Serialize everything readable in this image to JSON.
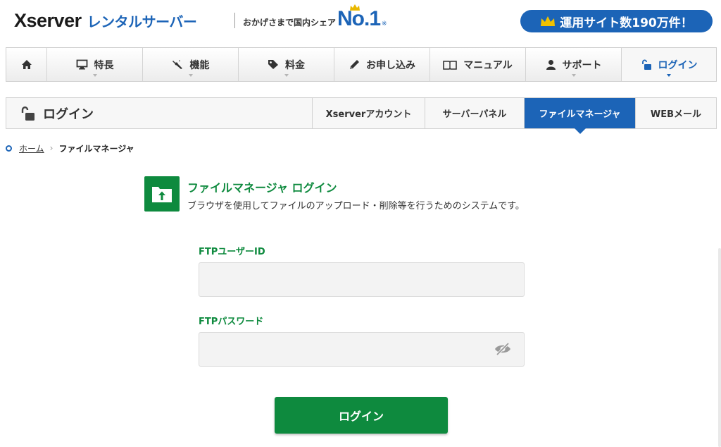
{
  "header": {
    "logo_main": "Xserver",
    "logo_sub": "レンタルサーバー",
    "tagline_text": "おかげさまで国内シェア",
    "tagline_no1": "No.1",
    "tagline_note": "※",
    "badge_text": "運用サイト数190万件！"
  },
  "nav": {
    "items": [
      {
        "label": "",
        "icon": "home-icon"
      },
      {
        "label": "特長",
        "icon": "monitor-icon"
      },
      {
        "label": "機能",
        "icon": "tools-icon"
      },
      {
        "label": "料金",
        "icon": "price-tag-icon"
      },
      {
        "label": "お申し込み",
        "icon": "pencil-icon"
      },
      {
        "label": "マニュアル",
        "icon": "book-icon"
      },
      {
        "label": "サポート",
        "icon": "user-icon"
      },
      {
        "label": "ログイン",
        "icon": "unlock-icon"
      }
    ]
  },
  "subnav": {
    "title": "ログイン",
    "tabs": [
      {
        "label": "Xserverアカウント"
      },
      {
        "label": "サーバーパネル"
      },
      {
        "label": "ファイルマネージャ"
      },
      {
        "label": "WEBメール"
      }
    ],
    "active_tab": "ファイルマネージャ"
  },
  "breadcrumb": {
    "home": "ホーム",
    "separator": "›",
    "current": "ファイルマネージャ"
  },
  "page": {
    "title": "ファイルマネージャ ログイン",
    "description": "ブラウザを使用してファイルのアップロード・削除等を行うためのシステムです。"
  },
  "form": {
    "user_id_label": "FTPユーザーID",
    "user_id_value": "",
    "password_label": "FTPパスワード",
    "password_value": "",
    "submit_label": "ログイン"
  },
  "colors": {
    "brand_blue": "#1c64b7",
    "brand_green": "#0e8a3e",
    "field_bg": "#f3f3f3"
  }
}
